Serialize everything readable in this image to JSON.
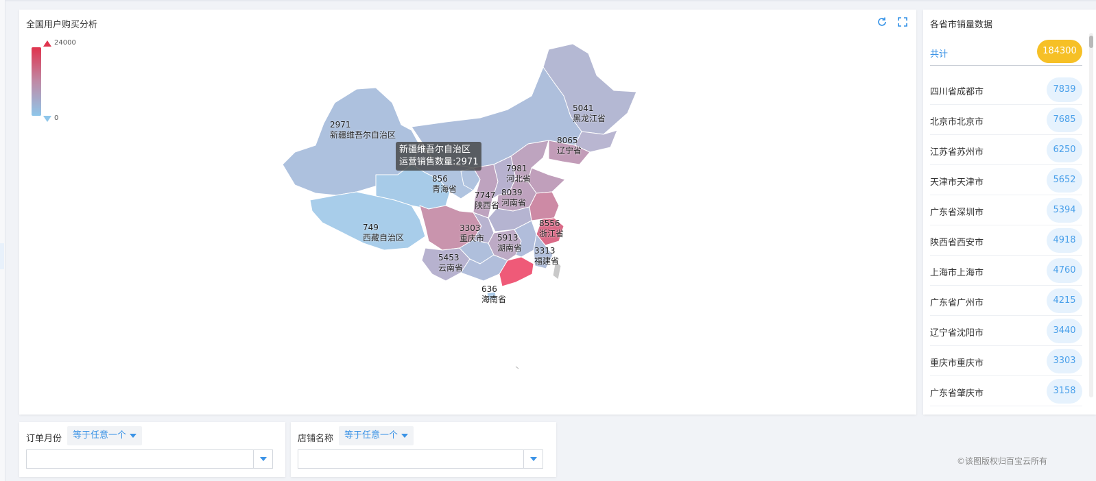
{
  "map_panel": {
    "title": "全国用户购买分析",
    "legend": {
      "max": "24000",
      "min": "0"
    },
    "tooltip": {
      "title": "新疆维吾尔自治区",
      "line": "运营销售数量:2971"
    },
    "labels": [
      {
        "id": "xinjiang",
        "value": "2971",
        "name": "新疆维吾尔自治区"
      },
      {
        "id": "heilongjiang",
        "value": "5041",
        "name": "黑龙江省"
      },
      {
        "id": "liaoning",
        "value": "8065",
        "name": "辽宁省"
      },
      {
        "id": "hebei",
        "value": "7981",
        "name": "河北省"
      },
      {
        "id": "qinghai",
        "value": "856",
        "name": "青海省"
      },
      {
        "id": "shaanxi",
        "value": "7747",
        "name": "陕西省"
      },
      {
        "id": "henan",
        "value": "8039",
        "name": "河南省"
      },
      {
        "id": "xizang",
        "value": "749",
        "name": "西藏自治区"
      },
      {
        "id": "chongqing",
        "value": "3303",
        "name": "重庆市"
      },
      {
        "id": "zhejiang",
        "value": "8556",
        "name": "浙江省"
      },
      {
        "id": "hunan",
        "value": "5913",
        "name": "湖南省"
      },
      {
        "id": "fujian",
        "value": "3313",
        "name": "福建省"
      },
      {
        "id": "yunnan",
        "value": "5453",
        "name": "云南省"
      },
      {
        "id": "hainan",
        "value": "636",
        "name": "海南省"
      }
    ],
    "colors": {
      "high": "#e0334d",
      "mid": "#bf8aa6",
      "low": "#8fc6ea"
    }
  },
  "side_panel": {
    "title": "各省市销量数据",
    "total_label": "共计",
    "total_value": "184300",
    "items": [
      {
        "name": "四川省成都市",
        "value": "7839"
      },
      {
        "name": "北京市北京市",
        "value": "7685"
      },
      {
        "name": "江苏省苏州市",
        "value": "6250"
      },
      {
        "name": "天津市天津市",
        "value": "5652"
      },
      {
        "name": "广东省深圳市",
        "value": "5394"
      },
      {
        "name": "陕西省西安市",
        "value": "4918"
      },
      {
        "name": "上海市上海市",
        "value": "4760"
      },
      {
        "name": "广东省广州市",
        "value": "4215"
      },
      {
        "name": "辽宁省沈阳市",
        "value": "3440"
      },
      {
        "name": "重庆市重庆市",
        "value": "3303"
      },
      {
        "name": "广东省肇庆市",
        "value": "3158"
      }
    ]
  },
  "filters": [
    {
      "label": "订单月份",
      "operator": "等于任意一个",
      "value": ""
    },
    {
      "label": "店铺名称",
      "operator": "等于任意一个",
      "value": ""
    }
  ],
  "footer": {
    "copyright": "©该图版权归百宝云所有"
  }
}
